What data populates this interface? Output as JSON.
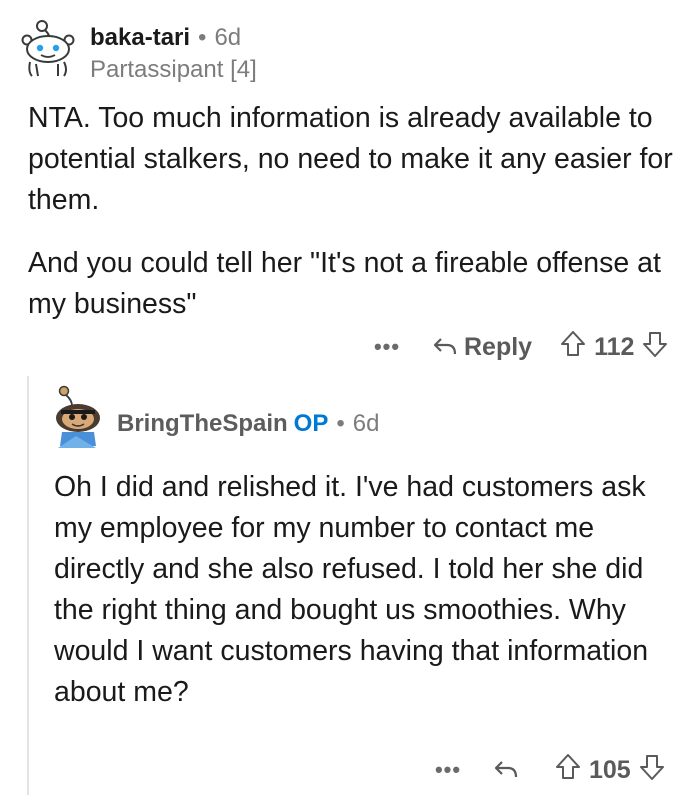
{
  "top_comment": {
    "author": "baka-tari",
    "separator": "•",
    "time": "6d",
    "flair": "Partassipant [4]",
    "paragraphs": [
      "NTA. Too much information is already available to potential stalkers, no need to make it any easier for them.",
      "And you could tell her \"It's not a fireable offense at my business\""
    ],
    "actions": {
      "more": "•••",
      "reply_label": "Reply",
      "score": "112"
    }
  },
  "reply_comment": {
    "author": "BringTheSpain",
    "op_badge": "OP",
    "separator": "•",
    "time": "6d",
    "body": "Oh I did and relished it. I've had customers ask my employee for my number to contact me directly and she also refused. I told her she did the right thing and bought us smoothies. Why would I want customers having that information about me?",
    "actions": {
      "more": "•••",
      "score": "105"
    }
  },
  "colors": {
    "text": "#1a1a1b",
    "meta": "#7c7c7c",
    "op_badge": "#0079d3",
    "thread_line": "#e3e3e3"
  }
}
